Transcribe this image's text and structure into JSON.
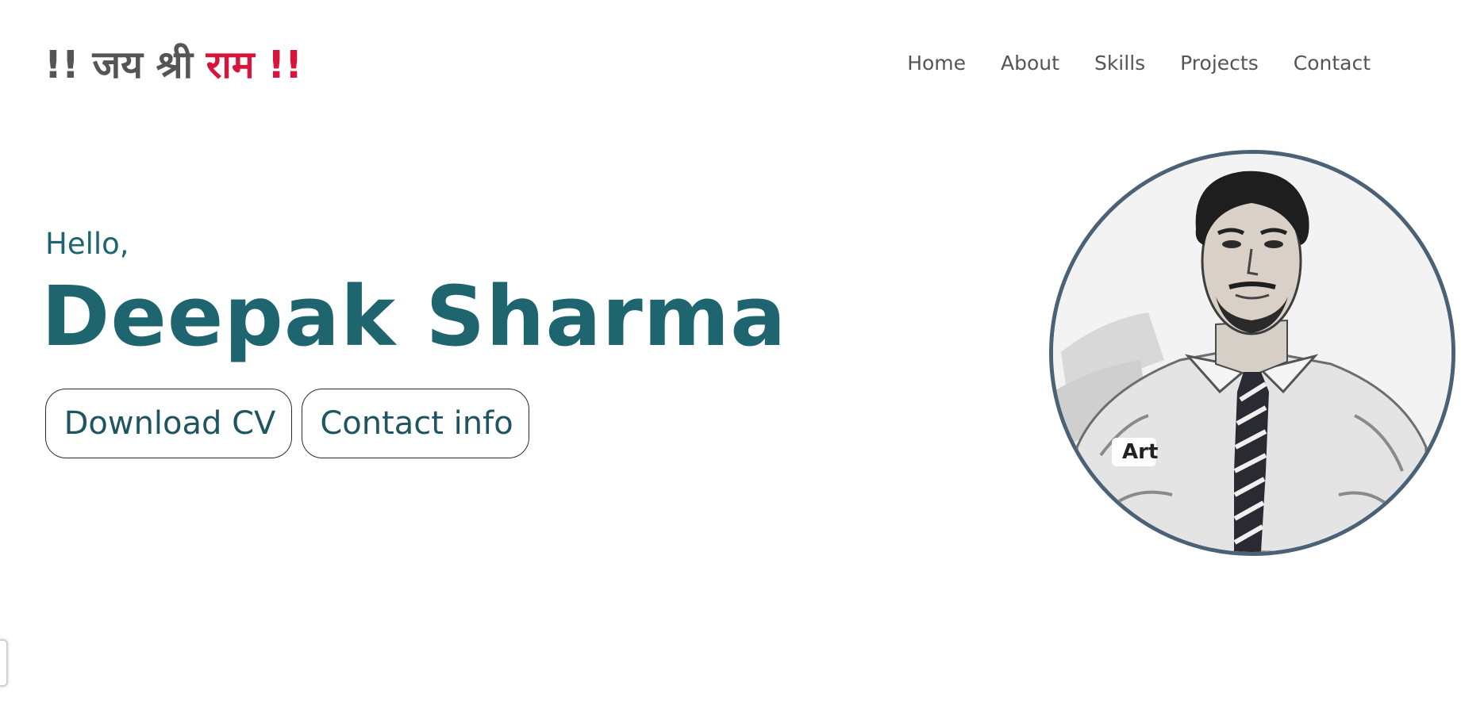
{
  "header": {
    "logo_prefix": "!! जय श्री ",
    "logo_accent": "राम !!",
    "nav": [
      {
        "label": "Home"
      },
      {
        "label": "About"
      },
      {
        "label": "Skills"
      },
      {
        "label": "Projects"
      },
      {
        "label": "Contact"
      }
    ]
  },
  "hero": {
    "greeting": "Hello,",
    "name": "Deepak Sharma",
    "download_cv_label": "Download CV",
    "contact_info_label": "Contact info"
  },
  "avatar": {
    "badge_text": "Art"
  },
  "colors": {
    "accent": "#d7143c",
    "primary": "#1e6570",
    "nav_text": "#555555",
    "avatar_border": "#4b6276"
  }
}
